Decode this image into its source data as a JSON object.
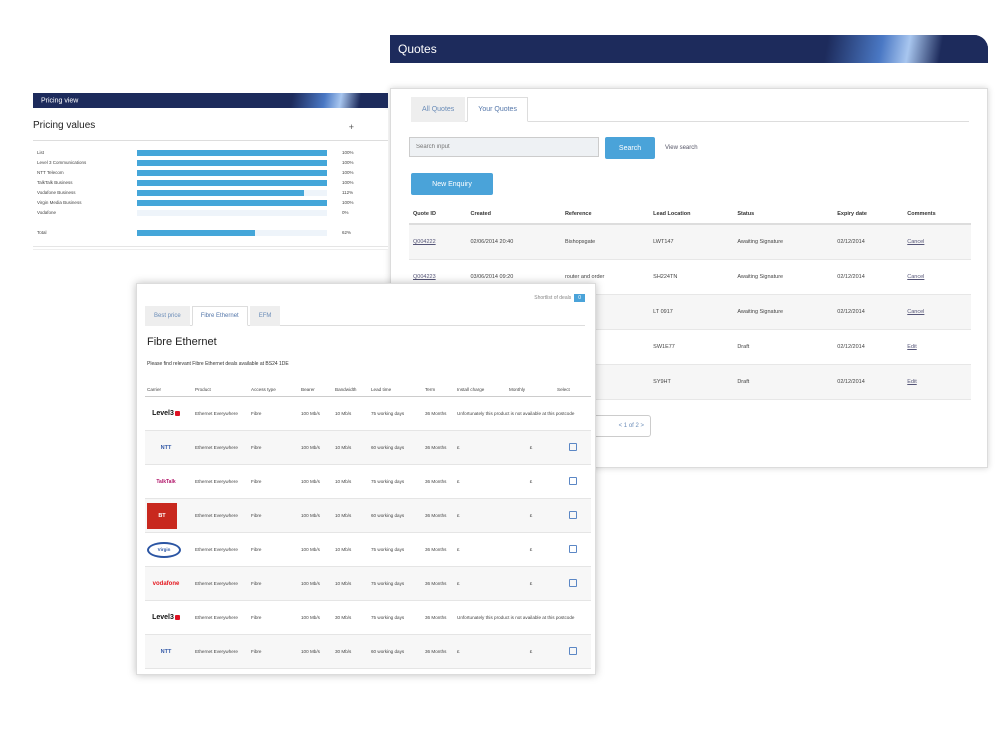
{
  "quotes": {
    "banner_title": "Quotes",
    "tabs": [
      {
        "label": "All Quotes",
        "active": false
      },
      {
        "label": "Your Quotes",
        "active": true
      }
    ],
    "search_placeholder": "Search input",
    "search_button": "Search",
    "view_all": "View search",
    "new_enquiry_button": "New Enquiry",
    "columns": [
      "Quote ID",
      "Created",
      "Reference",
      "Lead Location",
      "Status",
      "Expiry date",
      "Comments"
    ],
    "rows": [
      [
        "Q004222",
        "02/06/2014 20:40",
        "Bishopsgate",
        "LWT147",
        "Awaiting Signature",
        "02/12/2014",
        "Cancel"
      ],
      [
        "Q004223",
        "03/06/2014 09:20",
        "router and order",
        "SH224TN",
        "Awaiting Signature",
        "02/12/2014",
        "Cancel"
      ],
      [
        "",
        "",
        "",
        "LT 0917",
        "Awaiting Signature",
        "02/12/2014",
        "Cancel"
      ],
      [
        "",
        "",
        "",
        "SW1E77",
        "Draft",
        "02/12/2014",
        "Edit"
      ],
      [
        "",
        "",
        "",
        "SY9HT",
        "Draft",
        "02/12/2014",
        "Edit"
      ]
    ],
    "pager_label": "< 1 of 2 >"
  },
  "pricing": {
    "banner_title": "Pricing view",
    "title": "Pricing values",
    "plus": "+",
    "rows": [
      {
        "label": "List",
        "fill": 1.0,
        "value": "100%"
      },
      {
        "label": "Level 3 Communications",
        "fill": 1.0,
        "value": "100%"
      },
      {
        "label": "NTT Telecom",
        "fill": 1.0,
        "value": "100%"
      },
      {
        "label": "TalkTalk Business",
        "fill": 1.0,
        "value": "100%"
      },
      {
        "label": "Vodafone Business",
        "fill": 0.88,
        "value": "112%"
      },
      {
        "label": "Virgin Media Business",
        "fill": 1.0,
        "value": "100%"
      },
      {
        "label": "Vodafone",
        "fill": 0.0,
        "value": "0%"
      },
      {
        "label": "Total",
        "fill": 0.62,
        "value": "62%"
      }
    ]
  },
  "fibre": {
    "shortlist_label": "Shortlist of deals",
    "shortlist_count": "0",
    "tabs": [
      {
        "label": "Best price",
        "active": false
      },
      {
        "label": "Fibre Ethernet",
        "active": true
      },
      {
        "label": "EFM",
        "active": false
      }
    ],
    "title": "Fibre Ethernet",
    "description": "Please find relevant Fibre Ethernet deals available at BS24 1DE",
    "columns": [
      "Carrier",
      "Product",
      "Access type",
      "Bearer",
      "Bandwidth",
      "Lead time",
      "Term",
      "Install charge",
      "Monthly",
      "Select"
    ],
    "rows": [
      {
        "logo": "Level3",
        "logo_class": "level3",
        "product": "Ethernet Everywhere",
        "access": "Fibre",
        "bearer": "100 Mb/s",
        "bandwidth": "10 Mb/s",
        "lead": "75 working days",
        "term": "36 Months",
        "note": "Unfortunately this product is not available at this postcode",
        "install": "",
        "monthly": "",
        "select": false
      },
      {
        "logo": "NTT",
        "logo_class": "ntt",
        "product": "Ethernet Everywhere",
        "access": "Fibre",
        "bearer": "100 Mb/s",
        "bandwidth": "10 Mb/s",
        "lead": "60 working days",
        "term": "36 Months",
        "note": "",
        "install": "£",
        "monthly": "£",
        "select": true
      },
      {
        "logo": "TalkTalk",
        "logo_class": "talktalk",
        "product": "Ethernet Everywhere",
        "access": "Fibre",
        "bearer": "100 Mb/s",
        "bandwidth": "10 Mb/s",
        "lead": "75 working days",
        "term": "36 Months",
        "note": "",
        "install": "£",
        "monthly": "£",
        "select": true
      },
      {
        "logo": "BT",
        "logo_class": "red",
        "product": "Ethernet Everywhere",
        "access": "Fibre",
        "bearer": "100 Mb/s",
        "bandwidth": "10 Mb/s",
        "lead": "60 working days",
        "term": "36 Months",
        "note": "",
        "install": "£",
        "monthly": "£",
        "select": true
      },
      {
        "logo": "Virgin",
        "logo_class": "blue-swoosh",
        "product": "Ethernet Everywhere",
        "access": "Fibre",
        "bearer": "100 Mb/s",
        "bandwidth": "10 Mb/s",
        "lead": "75 working days",
        "term": "36 Months",
        "note": "",
        "install": "£",
        "monthly": "£",
        "select": true
      },
      {
        "logo": "vodafone",
        "logo_class": "vodafone",
        "product": "Ethernet Everywhere",
        "access": "Fibre",
        "bearer": "100 Mb/s",
        "bandwidth": "10 Mb/s",
        "lead": "75 working days",
        "term": "36 Months",
        "note": "",
        "install": "£",
        "monthly": "£",
        "select": true
      },
      {
        "logo": "Level3",
        "logo_class": "level3",
        "product": "Ethernet Everywhere",
        "access": "Fibre",
        "bearer": "100 Mb/s",
        "bandwidth": "30 Mb/s",
        "lead": "75 working days",
        "term": "36 Months",
        "note": "Unfortunately this product is not available at this postcode",
        "install": "",
        "monthly": "",
        "select": false
      },
      {
        "logo": "NTT",
        "logo_class": "ntt",
        "product": "Ethernet Everywhere",
        "access": "Fibre",
        "bearer": "100 Mb/s",
        "bandwidth": "30 Mb/s",
        "lead": "60 working days",
        "term": "36 Months",
        "note": "",
        "install": "£",
        "monthly": "£",
        "select": true
      }
    ]
  },
  "colors": {
    "banner": "#1d2b5c",
    "accent": "#4aa3d9"
  }
}
